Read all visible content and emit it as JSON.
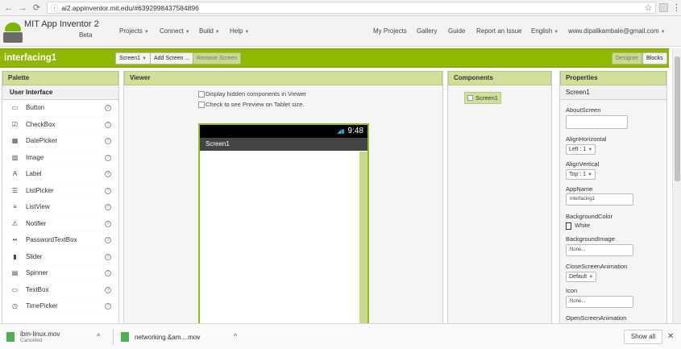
{
  "browser": {
    "url": "ai2.appinventor.mit.edu/#6392998437584896"
  },
  "header": {
    "app_title": "MIT App Inventor 2",
    "beta": "Beta",
    "menus": [
      "Projects",
      "Connect",
      "Build",
      "Help"
    ],
    "right_links": [
      "My Projects",
      "Gallery",
      "Guide",
      "Report an Issue",
      "English"
    ],
    "user_email": "www.dipalikambale@gmail.com"
  },
  "toolbar": {
    "project_name": "interfacing1",
    "screen_select": "Screen1",
    "add_screen": "Add Screen ...",
    "remove_screen": "Remove Screen",
    "designer": "Designer",
    "blocks": "Blocks"
  },
  "palette": {
    "title": "Palette",
    "category": "User Interface",
    "items": [
      {
        "label": "Button",
        "icon": "button-icon"
      },
      {
        "label": "CheckBox",
        "icon": "checkbox-icon"
      },
      {
        "label": "DatePicker",
        "icon": "datepicker-icon"
      },
      {
        "label": "Image",
        "icon": "image-icon"
      },
      {
        "label": "Label",
        "icon": "label-icon"
      },
      {
        "label": "ListPicker",
        "icon": "listpicker-icon"
      },
      {
        "label": "ListView",
        "icon": "listview-icon"
      },
      {
        "label": "Notifier",
        "icon": "notifier-icon"
      },
      {
        "label": "PasswordTextBox",
        "icon": "password-icon"
      },
      {
        "label": "Slider",
        "icon": "slider-icon"
      },
      {
        "label": "Spinner",
        "icon": "spinner-icon"
      },
      {
        "label": "TextBox",
        "icon": "textbox-icon"
      },
      {
        "label": "TimePicker",
        "icon": "timepicker-icon"
      }
    ]
  },
  "viewer": {
    "title": "Viewer",
    "option_hidden": "Display hidden components in Viewer",
    "option_tablet": "Check to see Preview on Tablet size.",
    "phone_time": "9:48",
    "screen_title": "Screen1"
  },
  "components": {
    "title": "Components",
    "tree": [
      "Screen1"
    ]
  },
  "properties": {
    "title": "Properties",
    "component": "Screen1",
    "about_screen_label": "AboutScreen",
    "align_h_label": "AlignHorizontal",
    "align_h_value": "Left : 1",
    "align_v_label": "AlignVertical",
    "align_v_value": "Top : 1",
    "app_name_label": "AppName",
    "app_name_value": "interfacing1",
    "bg_color_label": "BackgroundColor",
    "bg_color_value": "White",
    "bg_image_label": "BackgroundImage",
    "bg_image_value": "None...",
    "close_anim_label": "CloseScreenAnimation",
    "close_anim_value": "Default",
    "icon_label": "Icon",
    "icon_value": "None...",
    "open_anim_label": "OpenScreenAnimation"
  },
  "downloads": {
    "items": [
      {
        "name": "ibm-linux.mov",
        "status": "Canceled"
      },
      {
        "name": "networking &am....mov",
        "status": ""
      }
    ],
    "show_all": "Show all"
  },
  "colors": {
    "accent_green": "#8fb800",
    "panel_header": "#cfe09a"
  }
}
